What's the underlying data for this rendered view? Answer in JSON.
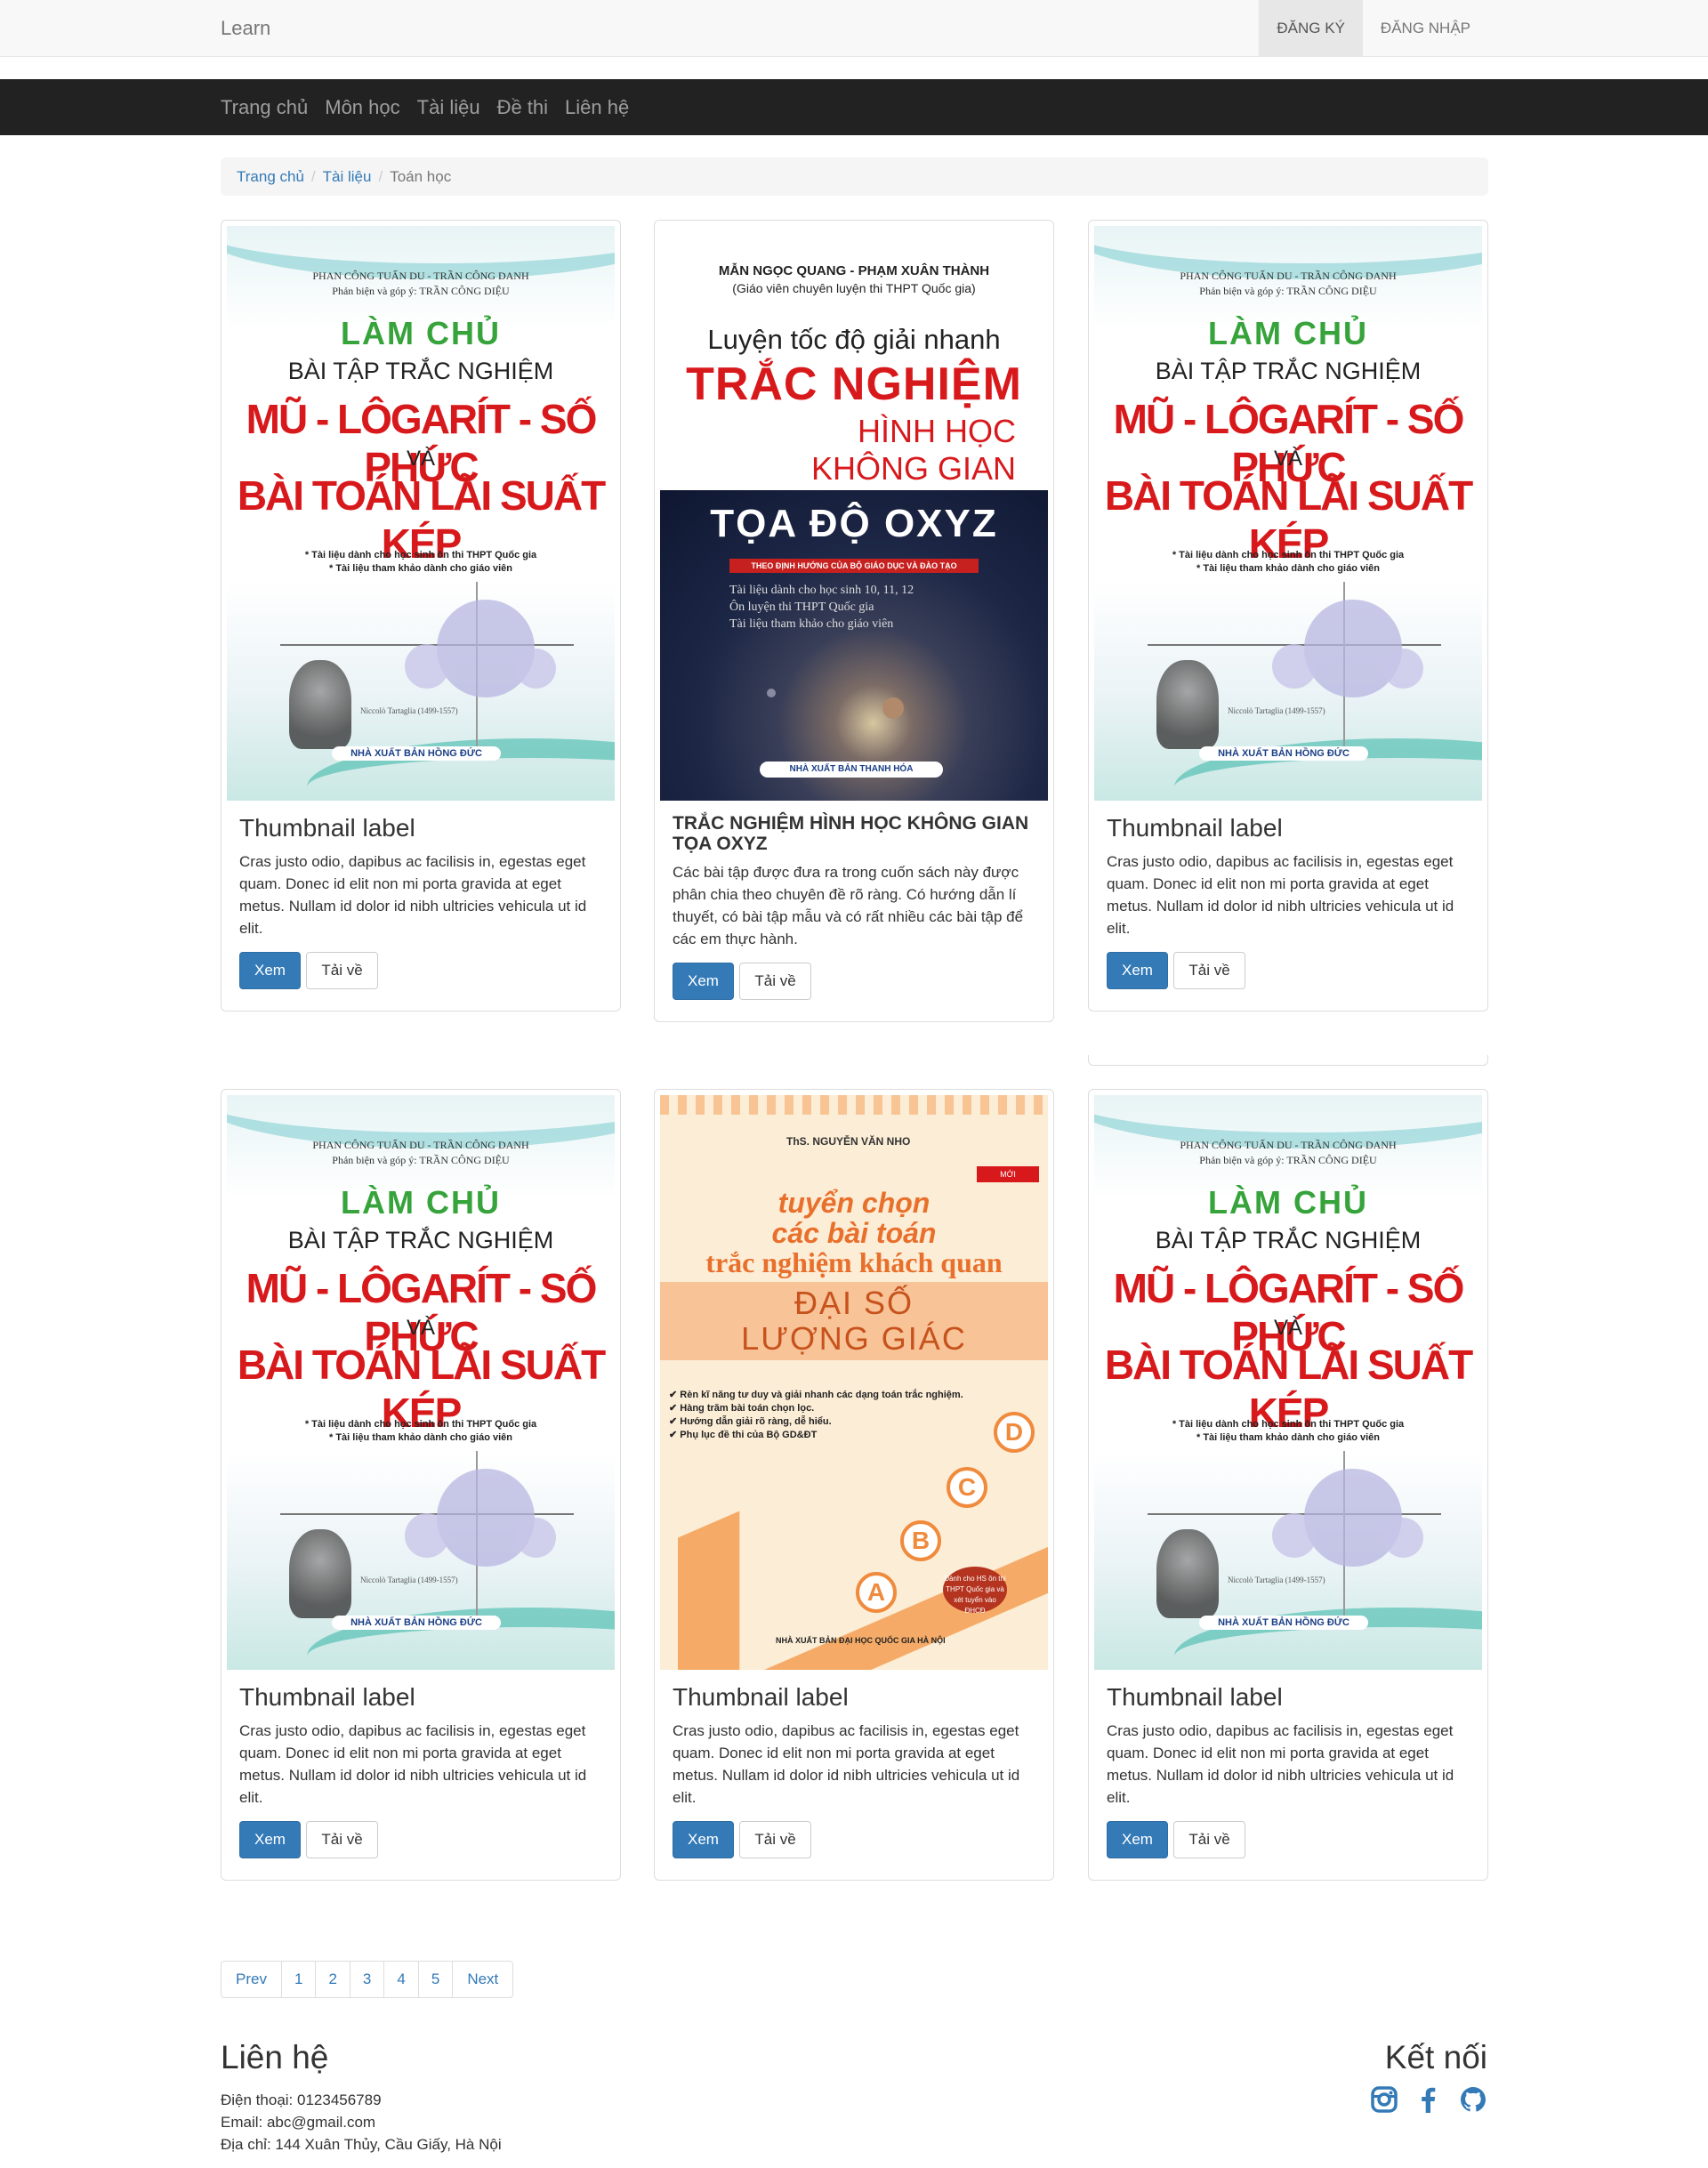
{
  "topbar": {
    "brand": "Learn",
    "register": "ĐĂNG KÝ",
    "login": "ĐĂNG NHẬP"
  },
  "nav": {
    "items": [
      "Trang chủ",
      "Môn học",
      "Tài liệu",
      "Đề thi",
      "Liên hệ"
    ]
  },
  "breadcrumb": {
    "home": "Trang chủ",
    "docs": "Tài liệu",
    "current": "Toán học"
  },
  "covers": {
    "a": {
      "authors1": "PHAN CÔNG TUẤN DU - TRẦN CÔNG DANH",
      "authors2": "Phản biện và góp ý: TRẦN CÔNG DIỆU",
      "lam_chu": "LÀM CHỦ",
      "bai_tap": "BÀI TẬP TRẮC NGHIỆM",
      "mu": "MŨ - LÔGARÍT - SỐ PHỨC",
      "va": "VÀ",
      "lai_suat": "BÀI TOÁN LÃI SUẤT KÉP",
      "note1": "* Tài liệu dành cho học sinh ôn thi THPT Quốc gia",
      "note2": "* Tài liệu tham khảo dành cho giáo viên",
      "caption": "Niccolò Tartaglia (1499-1557)",
      "publisher": "NHÀ XUẤT BẢN HỒNG ĐỨC"
    },
    "b": {
      "authors": "MẪN NGỌC QUANG - PHẠM XUÂN THÀNH",
      "authors_sub": "(Giáo viên chuyên luyện thi THPT Quốc gia)",
      "line1": "Luyện tốc độ giải nhanh",
      "line2": "TRẮC NGHIỆM",
      "line3": "HÌNH HỌC",
      "line4": "KHÔNG GIAN",
      "oxyz": "TỌA ĐỘ OXYZ",
      "band": "THEO ĐỊNH HƯỚNG CỦA BỘ GIÁO DỤC VÀ ĐÀO TẠO",
      "desc1": "Tài liệu dành cho học sinh 10, 11, 12",
      "desc2": "Ôn luyện thi THPT Quốc gia",
      "desc3": "Tài liệu tham khảo cho giáo viên",
      "publisher": "NHÀ XUẤT BẢN THANH HÓA"
    },
    "c": {
      "author": "ThS. NGUYỄN VĂN NHO",
      "moi": "MỚI",
      "t1a": "tuyển chọn",
      "t1b": "các bài toán",
      "t2": "trắc nghiệm khách quan",
      "t3a": "ĐẠI SỐ",
      "t3b": "LƯỢNG GIÁC",
      "b1": "Rèn kĩ năng tư duy và giải nhanh các dạng toán trắc nghiệm.",
      "b2": "Hàng trăm bài toán chọn lọc.",
      "b3": "Hướng dẫn giải rõ ràng, dễ hiểu.",
      "b4": "Phụ lục đề thi của Bộ GD&ĐT",
      "badge": "Dành cho HS ôn thi THPT Quốc gia và xét tuyển vào ĐHCĐ",
      "publisher": "NHÀ XUẤT BẢN ĐẠI HỌC QUỐC GIA HÀ NỘI",
      "letters": [
        "A",
        "B",
        "C",
        "D"
      ]
    }
  },
  "cards": [
    {
      "title": "Thumbnail label",
      "text": "Cras justo odio, dapibus ac facilisis in, egestas eget quam. Donec id elit non mi porta gravida at eget metus. Nullam id dolor id nibh ultricies vehicula ut id elit.",
      "view": "Xem",
      "download": "Tải về"
    },
    {
      "title": "TRẮC NGHIỆM HÌNH HỌC KHÔNG GIAN TỌA OXYZ",
      "text": "Các bài tập được đưa ra trong cuốn sách này được phân chia theo chuyên đề rõ ràng. Có hướng dẫn lí thuyết, có bài tập mẫu và có rất nhiều các bài tập để các em thực hành.",
      "view": "Xem",
      "download": "Tải về"
    },
    {
      "title": "Thumbnail label",
      "text": "Cras justo odio, dapibus ac facilisis in, egestas eget quam. Donec id elit non mi porta gravida at eget metus. Nullam id dolor id nibh ultricies vehicula ut id elit.",
      "view": "Xem",
      "download": "Tải về"
    },
    {
      "title": "Thumbnail label",
      "text": "Cras justo odio, dapibus ac facilisis in, egestas eget quam. Donec id elit non mi porta gravida at eget metus. Nullam id dolor id nibh ultricies vehicula ut id elit.",
      "view": "Xem",
      "download": "Tải về"
    },
    {
      "title": "Thumbnail label",
      "text": "Cras justo odio, dapibus ac facilisis in, egestas eget quam. Donec id elit non mi porta gravida at eget metus. Nullam id dolor id nibh ultricies vehicula ut id elit.",
      "view": "Xem",
      "download": "Tải về"
    },
    {
      "title": "Thumbnail label",
      "text": "Cras justo odio, dapibus ac facilisis in, egestas eget quam. Donec id elit non mi porta gravida at eget metus. Nullam id dolor id nibh ultricies vehicula ut id elit.",
      "view": "Xem",
      "download": "Tải về"
    }
  ],
  "pagination": {
    "prev": "Prev",
    "pages": [
      "1",
      "2",
      "3",
      "4",
      "5"
    ],
    "next": "Next"
  },
  "footer": {
    "contact_title": "Liên hệ",
    "phone": "Điện thoại: 0123456789",
    "email": "Email: abc@gmail.com",
    "address": "Địa chỉ: 144 Xuân Thủy, Cầu Giấy, Hà Nội",
    "connect_title": "Kết nối"
  },
  "social_icons": [
    "instagram-icon",
    "facebook-icon",
    "github-icon"
  ],
  "colors": {
    "primary": "#337ab7",
    "nav_dark": "#222222",
    "accent_red": "#d8191c"
  }
}
